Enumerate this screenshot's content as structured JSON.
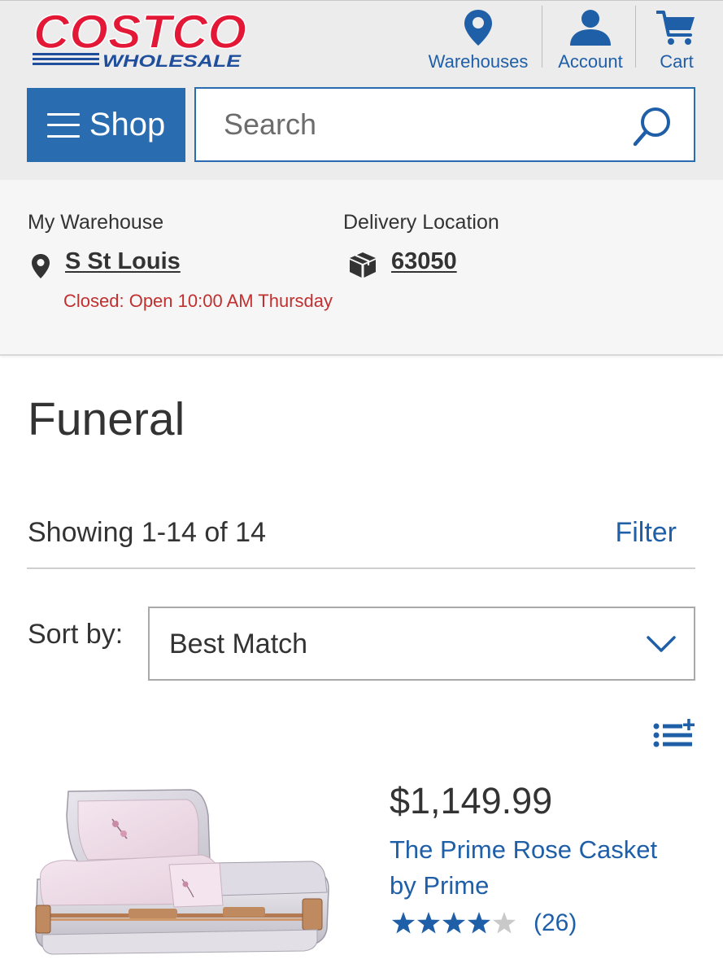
{
  "header": {
    "logo_text_top": "COSTCO",
    "logo_text_bottom": "WHOLESALE",
    "nav": [
      {
        "label": "Warehouses",
        "icon": "map-pin-icon"
      },
      {
        "label": "Account",
        "icon": "user-icon"
      },
      {
        "label": "Cart",
        "icon": "cart-icon"
      }
    ],
    "shop_label": "Shop",
    "search_placeholder": "Search"
  },
  "location": {
    "warehouse_label": "My Warehouse",
    "warehouse_value": "S St Louis",
    "warehouse_status": "Closed: Open 10:00 AM Thursday",
    "delivery_label": "Delivery Location",
    "delivery_value": "63050"
  },
  "main": {
    "title": "Funeral",
    "showing": "Showing 1-14 of 14",
    "filter_label": "Filter",
    "sort_label": "Sort by:",
    "sort_value": "Best Match"
  },
  "products": [
    {
      "price": "$1,149.99",
      "name": "The Prime Rose Casket by Prime",
      "rating": 4.5,
      "reviews": "(26)"
    }
  ],
  "colors": {
    "brand_blue": "#2a6cb0",
    "link_blue": "#1f5fa8",
    "logo_red": "#e31837",
    "status_red": "#c0302f"
  }
}
